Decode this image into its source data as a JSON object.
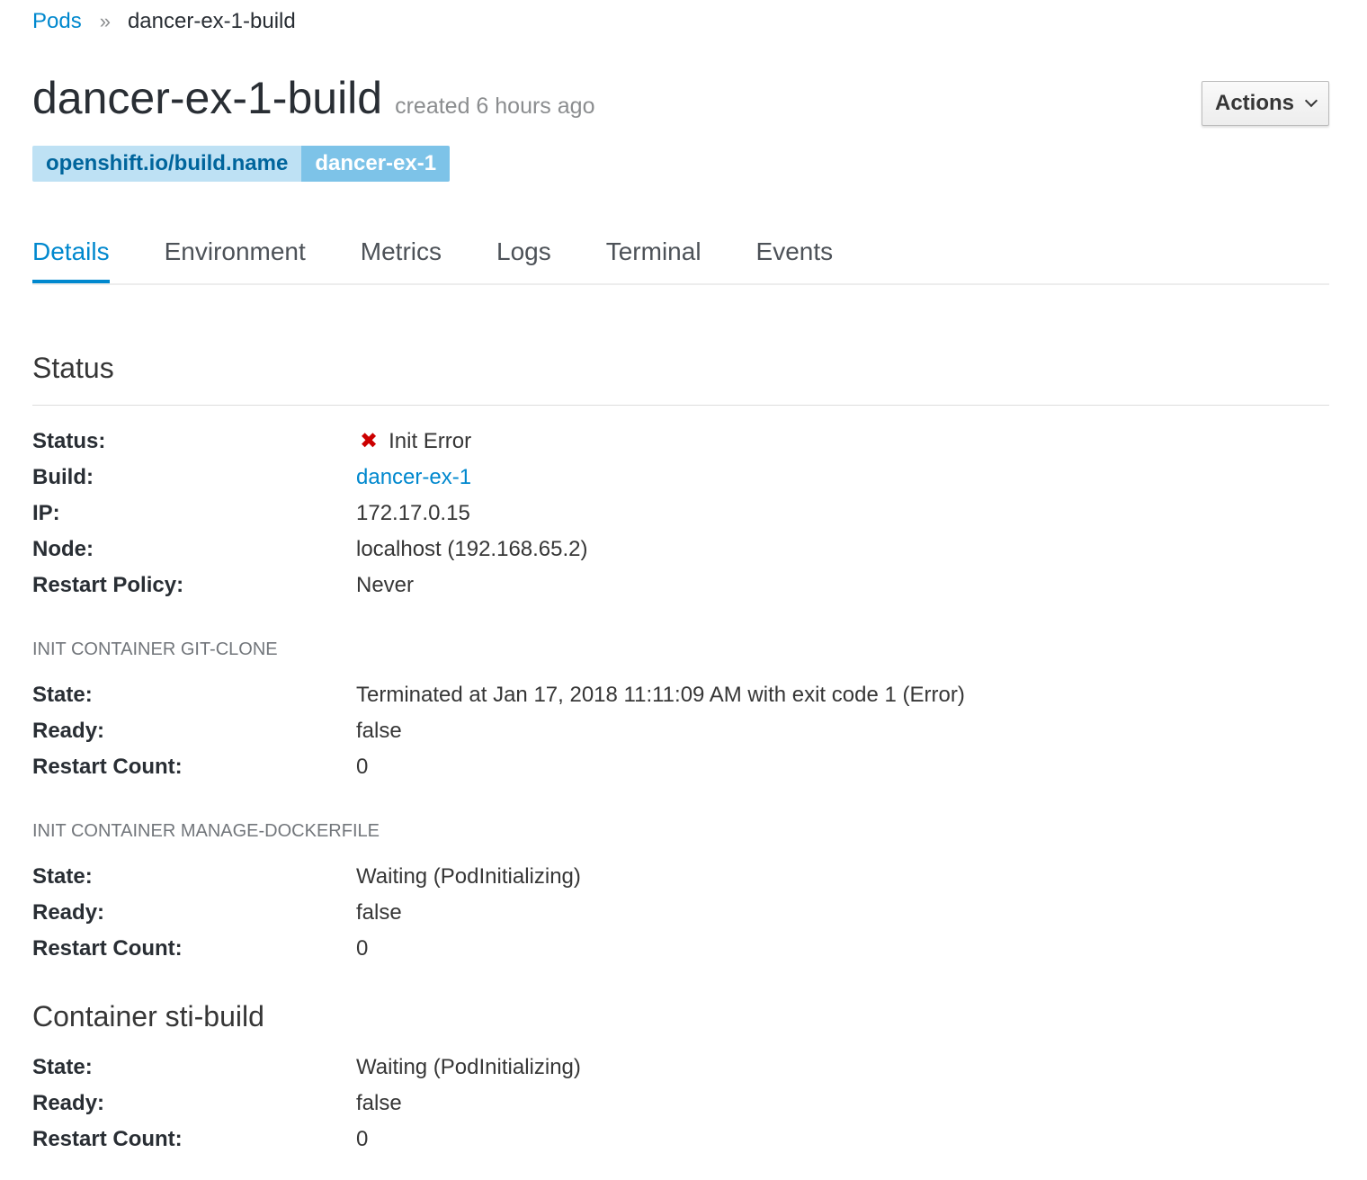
{
  "breadcrumb": {
    "parent": "Pods",
    "separator": "»",
    "current": "dancer-ex-1-build"
  },
  "header": {
    "title": "dancer-ex-1-build",
    "created": "created 6 hours ago",
    "actions_label": "Actions"
  },
  "label": {
    "key": "openshift.io/build.name",
    "value": "dancer-ex-1"
  },
  "tabs": [
    {
      "label": "Details",
      "active": true
    },
    {
      "label": "Environment",
      "active": false
    },
    {
      "label": "Metrics",
      "active": false
    },
    {
      "label": "Logs",
      "active": false
    },
    {
      "label": "Terminal",
      "active": false
    },
    {
      "label": "Events",
      "active": false
    }
  ],
  "status_section": {
    "title": "Status",
    "status_label": "Status:",
    "status_icon": "error-x-icon",
    "status_value": "Init Error",
    "build_label": "Build:",
    "build_value": "dancer-ex-1",
    "ip_label": "IP:",
    "ip_value": "172.17.0.15",
    "node_label": "Node:",
    "node_value": "localhost (192.168.65.2)",
    "restart_policy_label": "Restart Policy:",
    "restart_policy_value": "Never"
  },
  "init_git_clone": {
    "heading": "INIT CONTAINER GIT-CLONE",
    "state_label": "State:",
    "state_value": "Terminated at Jan 17, 2018 11:11:09 AM with exit code 1 (Error)",
    "ready_label": "Ready:",
    "ready_value": "false",
    "restart_count_label": "Restart Count:",
    "restart_count_value": "0"
  },
  "init_manage_dockerfile": {
    "heading": "INIT CONTAINER MANAGE-DOCKERFILE",
    "state_label": "State:",
    "state_value": "Waiting (PodInitializing)",
    "ready_label": "Ready:",
    "ready_value": "false",
    "restart_count_label": "Restart Count:",
    "restart_count_value": "0"
  },
  "container_sti_build": {
    "heading": "Container sti-build",
    "state_label": "State:",
    "state_value": "Waiting (PodInitializing)",
    "ready_label": "Ready:",
    "ready_value": "false",
    "restart_count_label": "Restart Count:",
    "restart_count_value": "0"
  },
  "colors": {
    "link": "#0088ce",
    "error": "#cc0000",
    "label_key_bg": "#bee1f4",
    "label_value_bg": "#7dc3e8"
  }
}
